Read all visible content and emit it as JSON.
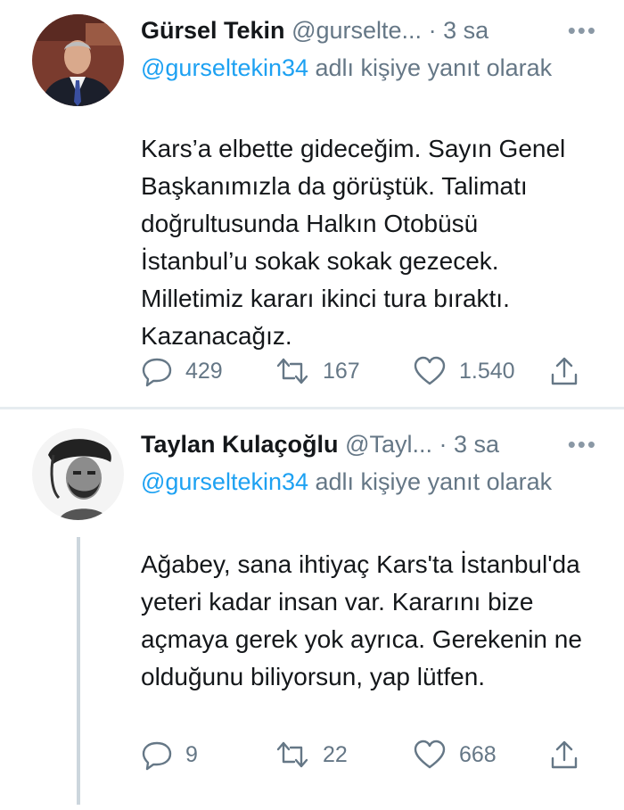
{
  "tweets": [
    {
      "name": "Gürsel Tekin",
      "handle": "@gurselte...",
      "dot": "·",
      "time": "3 sa",
      "more": "•••",
      "reply_mention": "@gurseltekin34",
      "reply_suffix": " adlı kişiye yanıt olarak",
      "body": "Kars’a elbette gideceğim. Sayın Genel Başkanımızla da görüştük. Talimatı doğrultusunda Halkın Otobüsü İstanbul’u sokak sokak gezecek. Milletimiz kararı ikinci tura bıraktı. Kazanacağız.",
      "replies": "429",
      "retweets": "167",
      "likes": "1.540"
    },
    {
      "name": "Taylan Kulaçoğlu",
      "handle": "@Tayl...",
      "dot": "·",
      "time": "3 sa",
      "more": "•••",
      "reply_mention": "@gurseltekin34",
      "reply_suffix": " adlı kişiye yanıt olarak",
      "body": "Ağabey, sana ihtiyaç Kars'ta İstanbul'da yeteri kadar insan var. Kararını bize açmaya gerek yok ayrıca. Gerekenin ne olduğunu biliyorsun, yap lütfen.",
      "replies": "9",
      "retweets": "22",
      "likes": "668"
    }
  ],
  "icons": {
    "reply": "reply-icon",
    "retweet": "retweet-icon",
    "like": "heart-icon",
    "share": "share-icon",
    "more": "more-icon"
  },
  "colors": {
    "mention": "#1da1f2",
    "secondary_text": "#657786",
    "divider": "#e6ecf0",
    "thread_line": "#ccd6dd"
  }
}
